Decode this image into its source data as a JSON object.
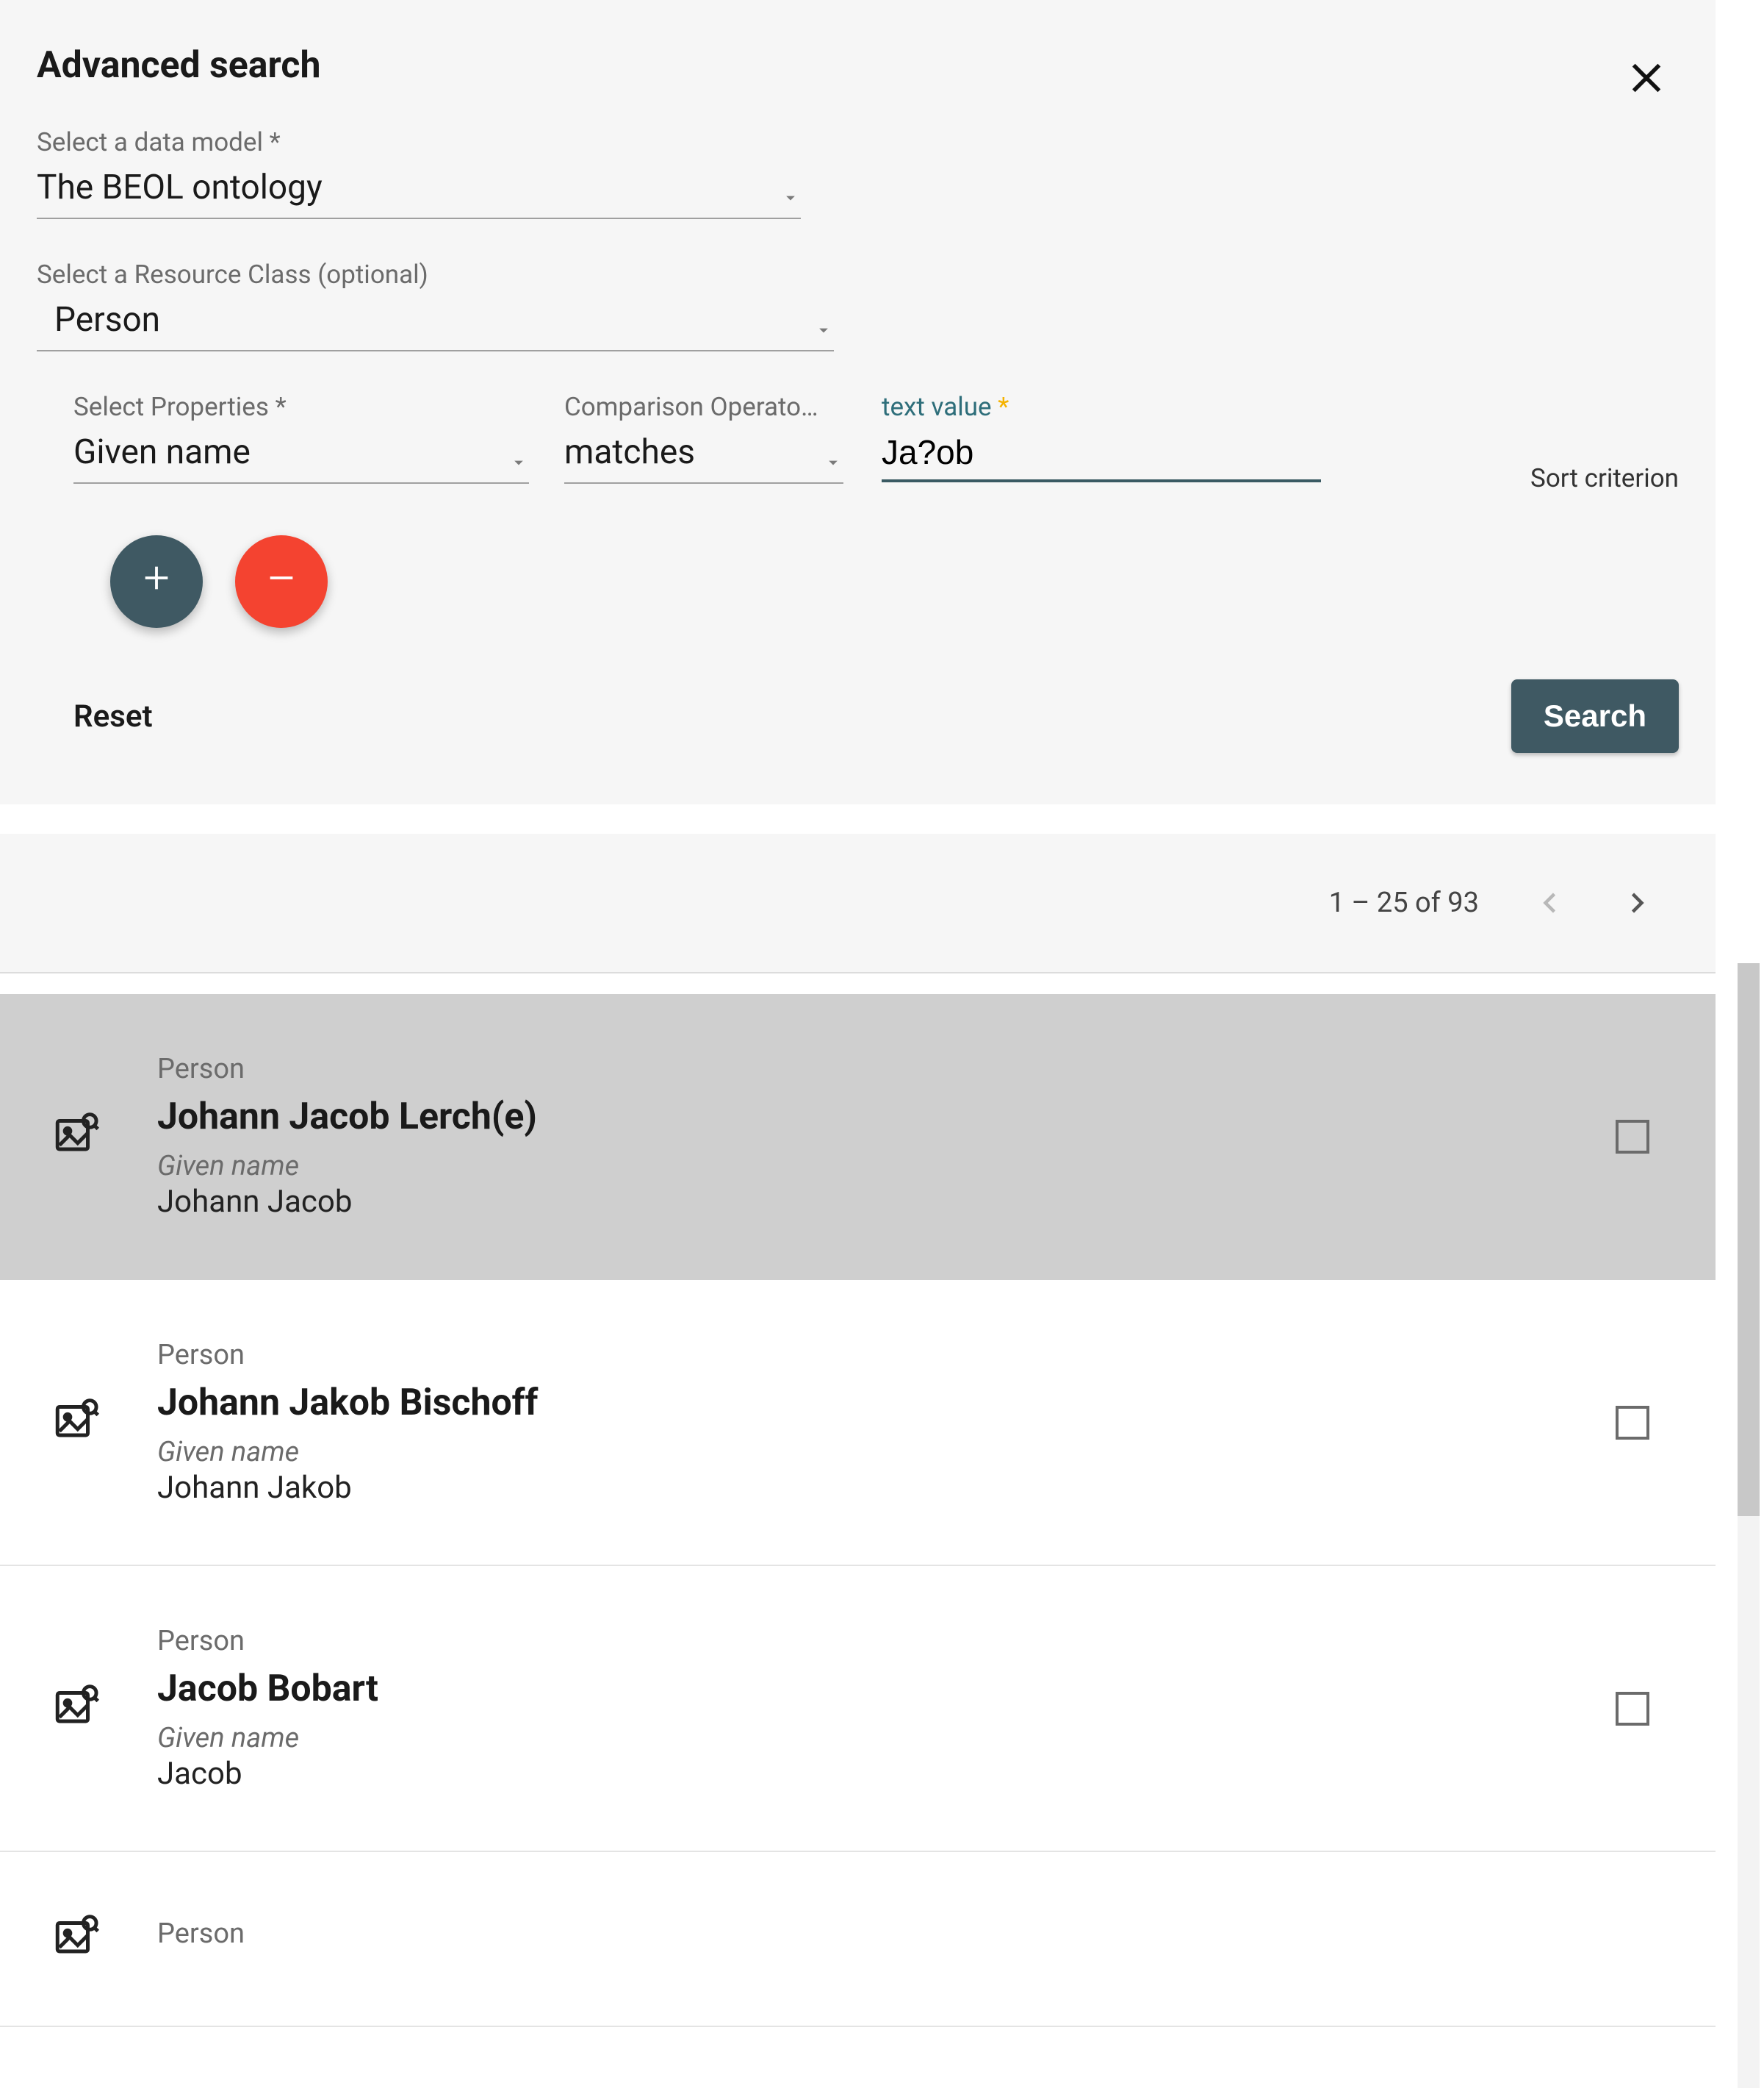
{
  "panel": {
    "title": "Advanced search",
    "data_model_label": "Select a data model *",
    "data_model_value": "The BEOL ontology",
    "resource_class_label": "Select a Resource Class (optional)",
    "resource_class_value": "Person",
    "sort_criterion": "Sort criterion",
    "reset": "Reset",
    "search": "Search"
  },
  "criteria": {
    "prop_label": "Select Properties *",
    "prop_value": "Given name",
    "op_label": "Comparison Operato…",
    "op_value": "matches",
    "val_label": "text value ",
    "val_ast": "*",
    "val_value": "Ja?ob"
  },
  "pager": {
    "range": "1 – 25 of 93"
  },
  "results": [
    {
      "type": "Person",
      "title": "Johann Jacob Lerch(e)",
      "prop": "Given name",
      "val": "Johann Jacob",
      "selected": true
    },
    {
      "type": "Person",
      "title": "Johann Jakob Bischoff",
      "prop": "Given name",
      "val": "Johann Jakob",
      "selected": false
    },
    {
      "type": "Person",
      "title": "Jacob Bobart",
      "prop": "Given name",
      "val": "Jacob",
      "selected": false
    },
    {
      "type": "Person",
      "title": "",
      "prop": "",
      "val": "",
      "selected": false
    }
  ]
}
